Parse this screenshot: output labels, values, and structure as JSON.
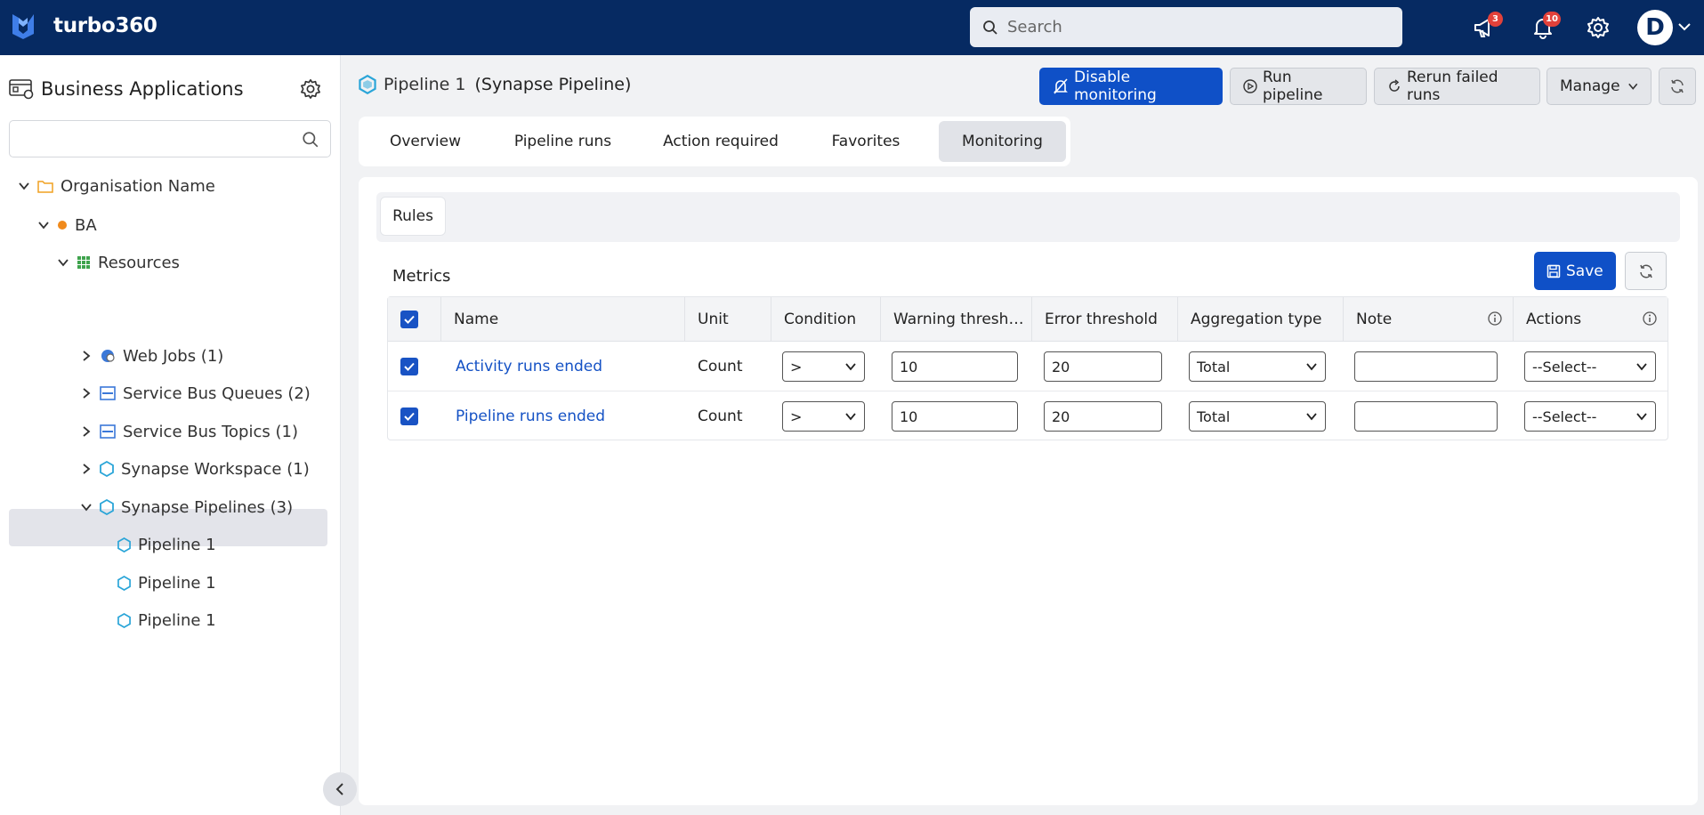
{
  "app": {
    "name": "turbo360"
  },
  "search": {
    "placeholder": "Search"
  },
  "notifications": {
    "announcements_count": "3",
    "alerts_count": "10"
  },
  "user": {
    "initial": "D"
  },
  "sidebar": {
    "title": "Business Applications",
    "search_value": "",
    "tree": [
      {
        "label": "Organisation Name"
      },
      {
        "label": "BA"
      },
      {
        "label": "Resources"
      },
      {
        "label": "Web Jobs (1)"
      },
      {
        "label": "Service Bus Queues (2)"
      },
      {
        "label": "Service Bus Topics (1)"
      },
      {
        "label": "Synapse Workspace (1)"
      },
      {
        "label": "Synapse Pipelines (3)"
      },
      {
        "label": "Pipeline 1"
      },
      {
        "label": "Pipeline 1"
      },
      {
        "label": "Pipeline 1"
      }
    ]
  },
  "header": {
    "resource_name": "Pipeline 1",
    "resource_type": "(Synapse Pipeline)",
    "buttons": {
      "disable_monitoring": "Disable monitoring",
      "run_pipeline": "Run pipeline",
      "rerun_failed": "Rerun failed runs",
      "manage": "Manage"
    }
  },
  "tabs": [
    {
      "label": "Overview"
    },
    {
      "label": "Pipeline runs"
    },
    {
      "label": "Action required"
    },
    {
      "label": "Favorites"
    },
    {
      "label": "Monitoring"
    }
  ],
  "active_tab": "Monitoring",
  "subtabs": [
    {
      "label": "Rules"
    }
  ],
  "metrics": {
    "label": "Metrics",
    "save_label": "Save",
    "columns": [
      "Name",
      "Unit",
      "Condition",
      "Warning thresh…",
      "Error threshold",
      "Aggregation type",
      "Note",
      "Actions"
    ],
    "rows": [
      {
        "checked": true,
        "name": "Activity runs ended",
        "unit": "Count",
        "condition": ">",
        "warning": "10",
        "error": "20",
        "aggregation": "Total",
        "note": "",
        "action": "--Select--"
      },
      {
        "checked": true,
        "name": "Pipeline runs ended",
        "unit": "Count",
        "condition": ">",
        "warning": "10",
        "error": "20",
        "aggregation": "Total",
        "note": "",
        "action": "--Select--"
      }
    ]
  },
  "colors": {
    "topbar": "#062a62",
    "primary": "#0f50c7",
    "link": "#1552c5",
    "badge": "#e2413a"
  }
}
